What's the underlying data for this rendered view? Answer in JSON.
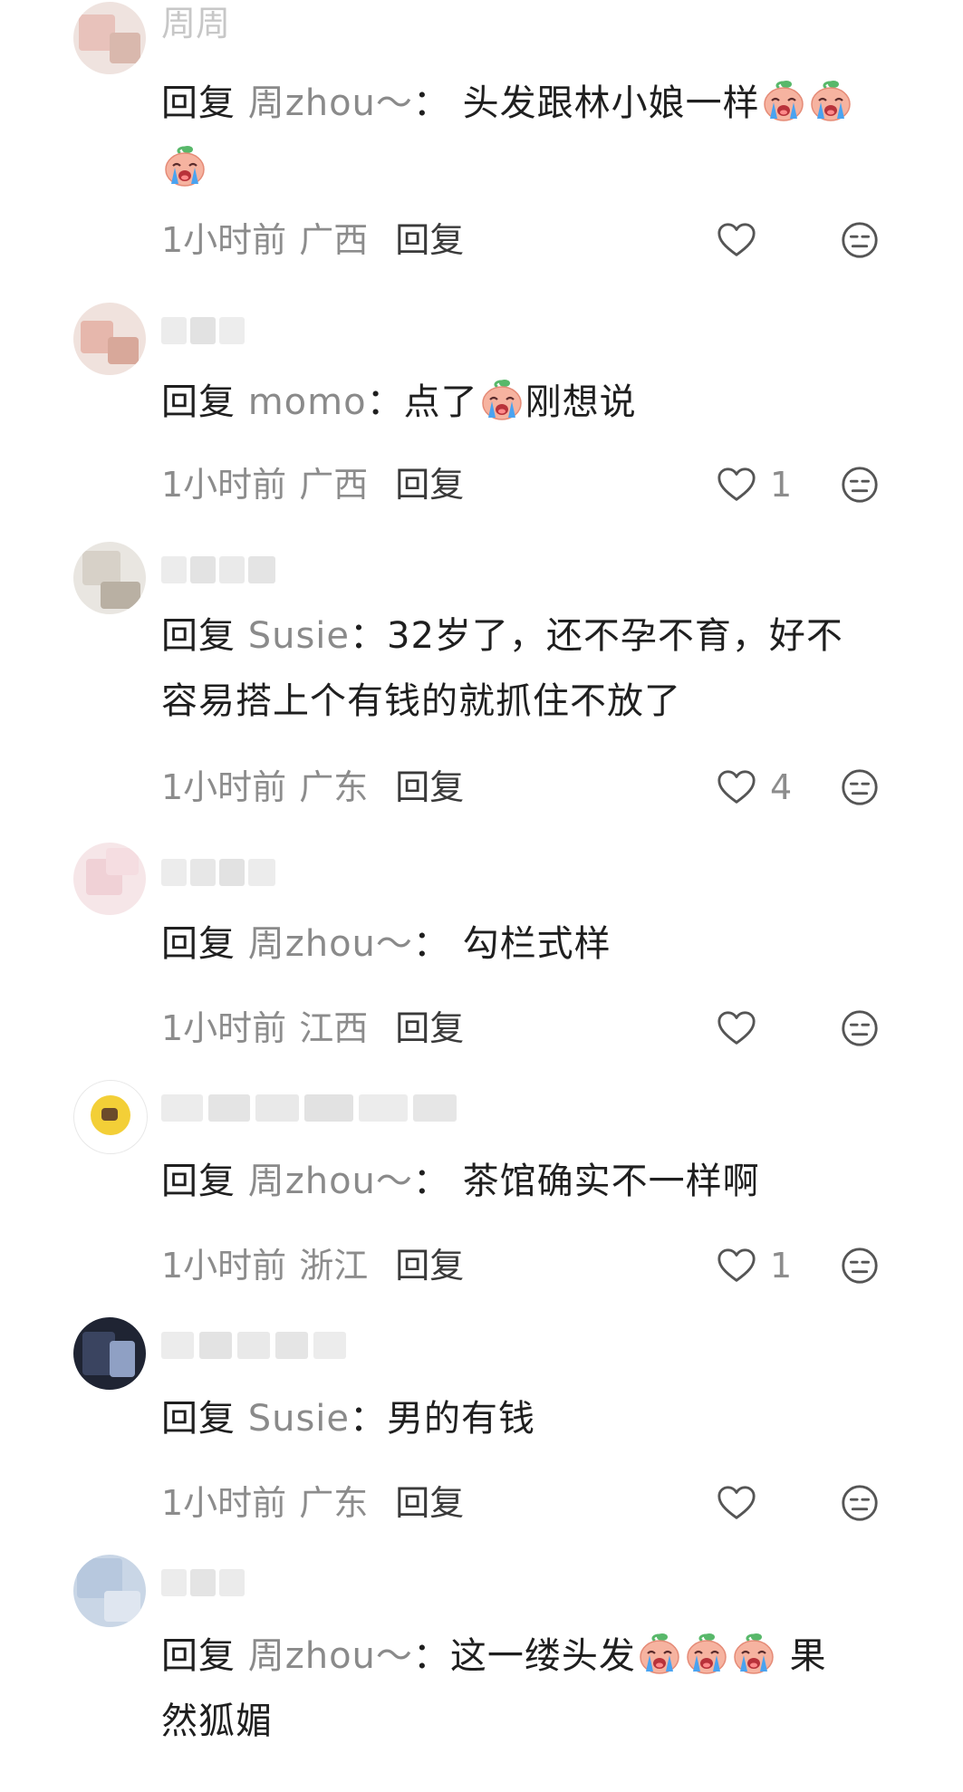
{
  "comments": [
    {
      "username": "周周",
      "reply_prefix": "回复",
      "reply_target": "周zhou～",
      "separator": "：",
      "text": "头发跟林小娘一样",
      "emoji_after": [
        "crying-face",
        "crying-face",
        "crying-face"
      ],
      "time": "1小时前",
      "region": "广西",
      "reply_label": "回复",
      "likes": ""
    },
    {
      "username": "",
      "reply_prefix": "回复",
      "reply_target": "momo",
      "separator": "：",
      "text_before": "点了",
      "text_after": "刚想说",
      "emoji_mid": "crying-face",
      "time": "1小时前",
      "region": "广西",
      "reply_label": "回复",
      "likes": "1"
    },
    {
      "username": "",
      "reply_prefix": "回复",
      "reply_target": "Susie",
      "separator": "：",
      "text_line1": "32岁了，还不孕不育，好不",
      "text_line2": "容易搭上个有钱的就抓住不放了",
      "time": "1小时前",
      "region": "广东",
      "reply_label": "回复",
      "likes": "4"
    },
    {
      "username": "",
      "reply_prefix": "回复",
      "reply_target": "周zhou～",
      "separator": "：",
      "text": "勾栏式样",
      "time": "1小时前",
      "region": "江西",
      "reply_label": "回复",
      "likes": ""
    },
    {
      "username": "",
      "reply_prefix": "回复",
      "reply_target": "周zhou～",
      "separator": "：",
      "text": "茶馆确实不一样啊",
      "time": "1小时前",
      "region": "浙江",
      "reply_label": "回复",
      "likes": "1"
    },
    {
      "username": "",
      "reply_prefix": "回复",
      "reply_target": "Susie",
      "separator": "：",
      "text": "男的有钱",
      "time": "1小时前",
      "region": "广东",
      "reply_label": "回复",
      "likes": ""
    },
    {
      "username": "",
      "reply_prefix": "回复",
      "reply_target": "周zhou～",
      "separator": "：",
      "text_before": "这一缕头发",
      "text_after": "果",
      "text_line2": "然狐媚",
      "emoji_mid": "crying-face",
      "time": "",
      "region": "",
      "reply_label": "",
      "likes": ""
    }
  ],
  "icons": {
    "like": "heart-outline-icon",
    "dislike": "meh-face-icon",
    "emoji": "crying-face-emoji"
  },
  "colors": {
    "text": "#1f1f1f",
    "muted": "#8c8c8c",
    "reply_target": "#8a8a8a",
    "emoji_face": "#f6b3a0",
    "emoji_tear": "#4aa3f0",
    "emoji_leaf": "#58b86a"
  }
}
